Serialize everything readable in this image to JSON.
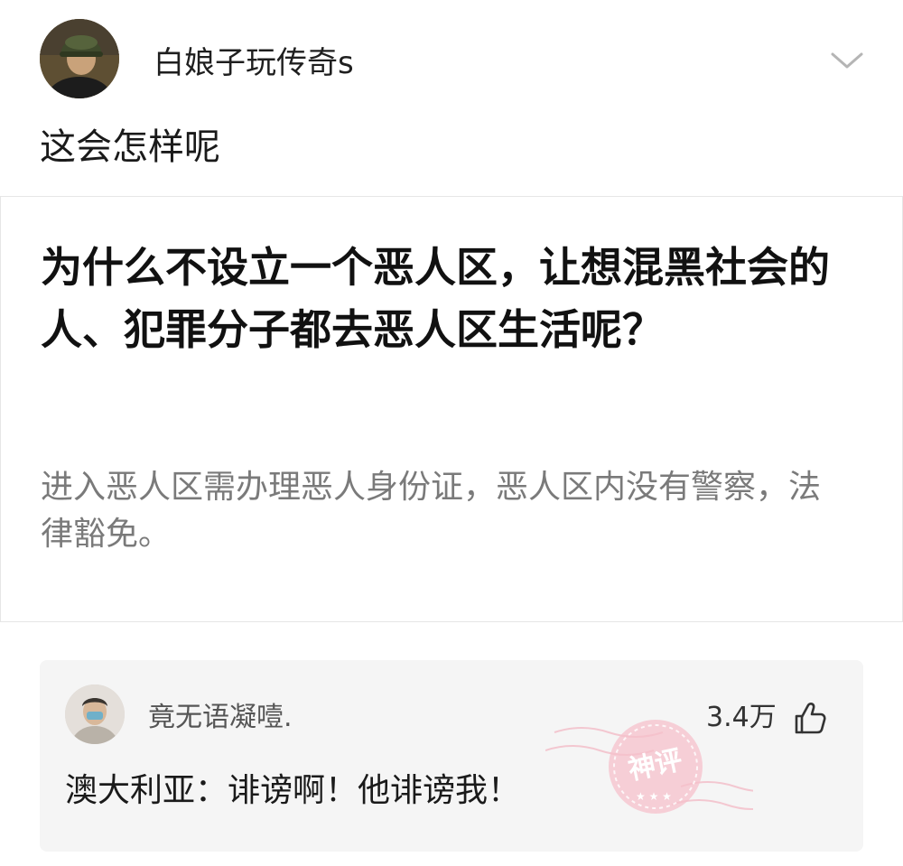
{
  "post": {
    "author_name": "白娘子玩传奇s",
    "text": "这会怎样呢"
  },
  "question": {
    "title": "为什么不设立一个恶人区，让想混黑社会的人、犯罪分子都去恶人区生活呢？",
    "detail": "进入恶人区需办理恶人身份证，恶人区内没有警察，法律豁免。"
  },
  "comment": {
    "author_name": "竟无语凝噎.",
    "likes": "3.4万",
    "text": "澳大利亚：诽谤啊！他诽谤我！",
    "stamp_label": "神评"
  },
  "icons": {
    "more": "chevron-down-icon",
    "like": "thumbs-up-icon"
  },
  "colors": {
    "stamp": "#f2a3b3",
    "comment_bg": "#f5f5f5"
  }
}
